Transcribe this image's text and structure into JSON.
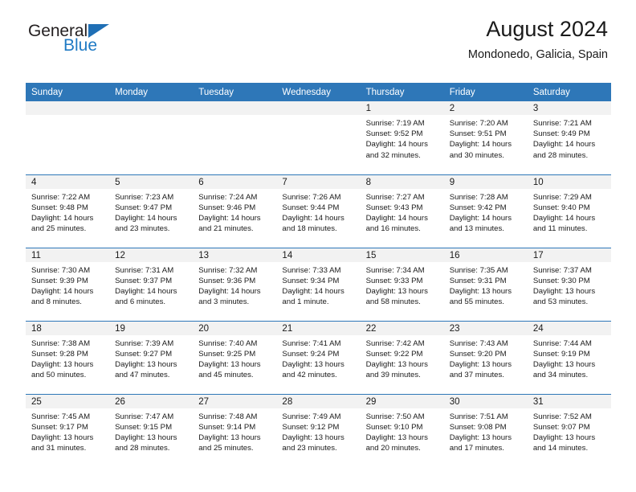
{
  "brand": {
    "name_part1": "General",
    "name_part2": "Blue",
    "triangle_color": "#1f6fb5",
    "blue_text_color": "#1f7ac4"
  },
  "header": {
    "title": "August 2024",
    "subtitle": "Mondonedo, Galicia, Spain"
  },
  "theme": {
    "header_blue": "#2e77b8",
    "daynum_band": "#f2f2f2",
    "text": "#1a1a1a"
  },
  "weekdays": [
    "Sunday",
    "Monday",
    "Tuesday",
    "Wednesday",
    "Thursday",
    "Friday",
    "Saturday"
  ],
  "weeks": [
    [
      {
        "day": "",
        "empty": true
      },
      {
        "day": "",
        "empty": true
      },
      {
        "day": "",
        "empty": true
      },
      {
        "day": "",
        "empty": true
      },
      {
        "day": "1",
        "sunrise": "Sunrise: 7:19 AM",
        "sunset": "Sunset: 9:52 PM",
        "daylight1": "Daylight: 14 hours",
        "daylight2": "and 32 minutes."
      },
      {
        "day": "2",
        "sunrise": "Sunrise: 7:20 AM",
        "sunset": "Sunset: 9:51 PM",
        "daylight1": "Daylight: 14 hours",
        "daylight2": "and 30 minutes."
      },
      {
        "day": "3",
        "sunrise": "Sunrise: 7:21 AM",
        "sunset": "Sunset: 9:49 PM",
        "daylight1": "Daylight: 14 hours",
        "daylight2": "and 28 minutes."
      }
    ],
    [
      {
        "day": "4",
        "sunrise": "Sunrise: 7:22 AM",
        "sunset": "Sunset: 9:48 PM",
        "daylight1": "Daylight: 14 hours",
        "daylight2": "and 25 minutes."
      },
      {
        "day": "5",
        "sunrise": "Sunrise: 7:23 AM",
        "sunset": "Sunset: 9:47 PM",
        "daylight1": "Daylight: 14 hours",
        "daylight2": "and 23 minutes."
      },
      {
        "day": "6",
        "sunrise": "Sunrise: 7:24 AM",
        "sunset": "Sunset: 9:46 PM",
        "daylight1": "Daylight: 14 hours",
        "daylight2": "and 21 minutes."
      },
      {
        "day": "7",
        "sunrise": "Sunrise: 7:26 AM",
        "sunset": "Sunset: 9:44 PM",
        "daylight1": "Daylight: 14 hours",
        "daylight2": "and 18 minutes."
      },
      {
        "day": "8",
        "sunrise": "Sunrise: 7:27 AM",
        "sunset": "Sunset: 9:43 PM",
        "daylight1": "Daylight: 14 hours",
        "daylight2": "and 16 minutes."
      },
      {
        "day": "9",
        "sunrise": "Sunrise: 7:28 AM",
        "sunset": "Sunset: 9:42 PM",
        "daylight1": "Daylight: 14 hours",
        "daylight2": "and 13 minutes."
      },
      {
        "day": "10",
        "sunrise": "Sunrise: 7:29 AM",
        "sunset": "Sunset: 9:40 PM",
        "daylight1": "Daylight: 14 hours",
        "daylight2": "and 11 minutes."
      }
    ],
    [
      {
        "day": "11",
        "sunrise": "Sunrise: 7:30 AM",
        "sunset": "Sunset: 9:39 PM",
        "daylight1": "Daylight: 14 hours",
        "daylight2": "and 8 minutes."
      },
      {
        "day": "12",
        "sunrise": "Sunrise: 7:31 AM",
        "sunset": "Sunset: 9:37 PM",
        "daylight1": "Daylight: 14 hours",
        "daylight2": "and 6 minutes."
      },
      {
        "day": "13",
        "sunrise": "Sunrise: 7:32 AM",
        "sunset": "Sunset: 9:36 PM",
        "daylight1": "Daylight: 14 hours",
        "daylight2": "and 3 minutes."
      },
      {
        "day": "14",
        "sunrise": "Sunrise: 7:33 AM",
        "sunset": "Sunset: 9:34 PM",
        "daylight1": "Daylight: 14 hours",
        "daylight2": "and 1 minute."
      },
      {
        "day": "15",
        "sunrise": "Sunrise: 7:34 AM",
        "sunset": "Sunset: 9:33 PM",
        "daylight1": "Daylight: 13 hours",
        "daylight2": "and 58 minutes."
      },
      {
        "day": "16",
        "sunrise": "Sunrise: 7:35 AM",
        "sunset": "Sunset: 9:31 PM",
        "daylight1": "Daylight: 13 hours",
        "daylight2": "and 55 minutes."
      },
      {
        "day": "17",
        "sunrise": "Sunrise: 7:37 AM",
        "sunset": "Sunset: 9:30 PM",
        "daylight1": "Daylight: 13 hours",
        "daylight2": "and 53 minutes."
      }
    ],
    [
      {
        "day": "18",
        "sunrise": "Sunrise: 7:38 AM",
        "sunset": "Sunset: 9:28 PM",
        "daylight1": "Daylight: 13 hours",
        "daylight2": "and 50 minutes."
      },
      {
        "day": "19",
        "sunrise": "Sunrise: 7:39 AM",
        "sunset": "Sunset: 9:27 PM",
        "daylight1": "Daylight: 13 hours",
        "daylight2": "and 47 minutes."
      },
      {
        "day": "20",
        "sunrise": "Sunrise: 7:40 AM",
        "sunset": "Sunset: 9:25 PM",
        "daylight1": "Daylight: 13 hours",
        "daylight2": "and 45 minutes."
      },
      {
        "day": "21",
        "sunrise": "Sunrise: 7:41 AM",
        "sunset": "Sunset: 9:24 PM",
        "daylight1": "Daylight: 13 hours",
        "daylight2": "and 42 minutes."
      },
      {
        "day": "22",
        "sunrise": "Sunrise: 7:42 AM",
        "sunset": "Sunset: 9:22 PM",
        "daylight1": "Daylight: 13 hours",
        "daylight2": "and 39 minutes."
      },
      {
        "day": "23",
        "sunrise": "Sunrise: 7:43 AM",
        "sunset": "Sunset: 9:20 PM",
        "daylight1": "Daylight: 13 hours",
        "daylight2": "and 37 minutes."
      },
      {
        "day": "24",
        "sunrise": "Sunrise: 7:44 AM",
        "sunset": "Sunset: 9:19 PM",
        "daylight1": "Daylight: 13 hours",
        "daylight2": "and 34 minutes."
      }
    ],
    [
      {
        "day": "25",
        "sunrise": "Sunrise: 7:45 AM",
        "sunset": "Sunset: 9:17 PM",
        "daylight1": "Daylight: 13 hours",
        "daylight2": "and 31 minutes."
      },
      {
        "day": "26",
        "sunrise": "Sunrise: 7:47 AM",
        "sunset": "Sunset: 9:15 PM",
        "daylight1": "Daylight: 13 hours",
        "daylight2": "and 28 minutes."
      },
      {
        "day": "27",
        "sunrise": "Sunrise: 7:48 AM",
        "sunset": "Sunset: 9:14 PM",
        "daylight1": "Daylight: 13 hours",
        "daylight2": "and 25 minutes."
      },
      {
        "day": "28",
        "sunrise": "Sunrise: 7:49 AM",
        "sunset": "Sunset: 9:12 PM",
        "daylight1": "Daylight: 13 hours",
        "daylight2": "and 23 minutes."
      },
      {
        "day": "29",
        "sunrise": "Sunrise: 7:50 AM",
        "sunset": "Sunset: 9:10 PM",
        "daylight1": "Daylight: 13 hours",
        "daylight2": "and 20 minutes."
      },
      {
        "day": "30",
        "sunrise": "Sunrise: 7:51 AM",
        "sunset": "Sunset: 9:08 PM",
        "daylight1": "Daylight: 13 hours",
        "daylight2": "and 17 minutes."
      },
      {
        "day": "31",
        "sunrise": "Sunrise: 7:52 AM",
        "sunset": "Sunset: 9:07 PM",
        "daylight1": "Daylight: 13 hours",
        "daylight2": "and 14 minutes."
      }
    ]
  ]
}
